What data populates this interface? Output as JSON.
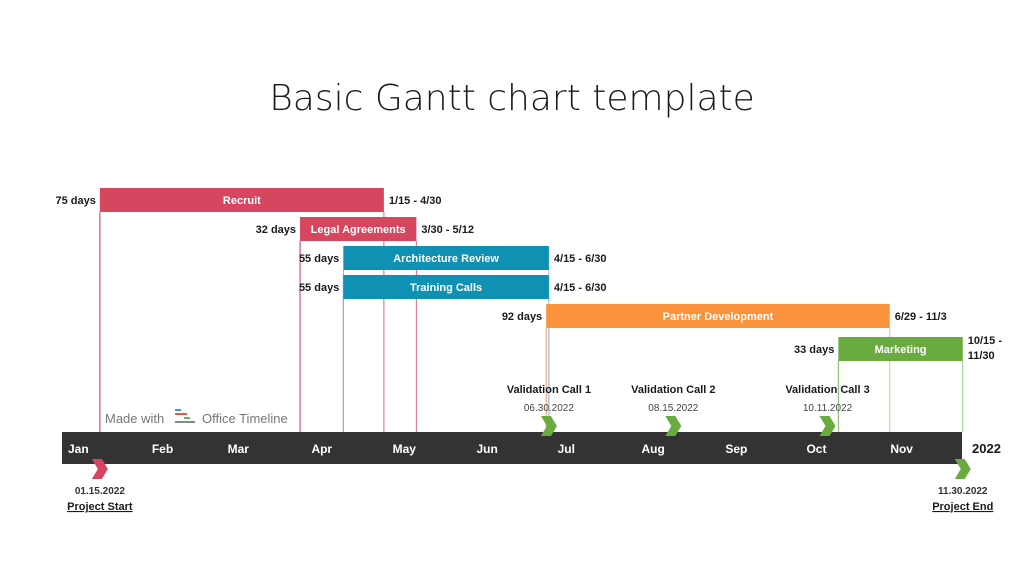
{
  "chart_data": {
    "type": "gantt",
    "title": "Basic Gantt chart template",
    "year_label": "2022",
    "months": [
      "Jan",
      "Feb",
      "Mar",
      "Apr",
      "May",
      "Jun",
      "Jul",
      "Aug",
      "Sep",
      "Oct",
      "Nov"
    ],
    "tasks": [
      {
        "name": "Recruit",
        "start": "2022-01-15",
        "end": "2022-04-30",
        "duration_label": "75 days",
        "range_label": "1/15 - 4/30",
        "color": "#d7465f",
        "line_color": "#c0394f"
      },
      {
        "name": "Legal Agreements",
        "start": "2022-03-30",
        "end": "2022-05-12",
        "duration_label": "32 days",
        "range_label": "3/30 - 5/12",
        "color": "#d7465f",
        "line_color": "#c0394f"
      },
      {
        "name": "Architecture Review",
        "start": "2022-04-15",
        "end": "2022-06-30",
        "duration_label": "55 days",
        "range_label": "4/15 - 6/30",
        "color": "#0f91b4",
        "line_color": "#8aa8e0"
      },
      {
        "name": "Training Calls",
        "start": "2022-04-15",
        "end": "2022-06-30",
        "duration_label": "55 days",
        "range_label": "4/15 - 6/30",
        "color": "#0f91b4",
        "line_color": "#8aa8e0"
      },
      {
        "name": "Partner Development",
        "start": "2022-06-29",
        "end": "2022-11-03",
        "duration_label": "92 days",
        "range_label": "6/29 - 11/3",
        "color": "#fb923c",
        "line_color": "#f59a4f"
      },
      {
        "name": "Marketing",
        "start": "2022-10-15",
        "end": "2022-11-30",
        "duration_label": "33 days",
        "range_label_lines": [
          "10/15 -",
          "11/30"
        ],
        "color": "#6aab40",
        "line_color": "#7bb65a"
      }
    ],
    "milestones_above": [
      {
        "name": "Validation Call 1",
        "date": "2022-06-30",
        "date_label": "06.30.2022",
        "color": "#6aab40"
      },
      {
        "name": "Validation Call 2",
        "date": "2022-08-15",
        "date_label": "08.15.2022",
        "color": "#6aab40"
      },
      {
        "name": "Validation Call 3",
        "date": "2022-10-11",
        "date_label": "10.11.2022",
        "color": "#6aab40"
      }
    ],
    "milestones_below": [
      {
        "name": "Project Start",
        "date": "2022-01-15",
        "date_label": "01.15.2022",
        "color": "#d7465f"
      },
      {
        "name": "Project End",
        "date": "2022-11-30",
        "date_label": "11.30.2022",
        "color": "#6aab40"
      }
    ],
    "timeline_color": "#333333",
    "watermark": {
      "prefix": "Made with",
      "brand": "Office Timeline"
    }
  }
}
